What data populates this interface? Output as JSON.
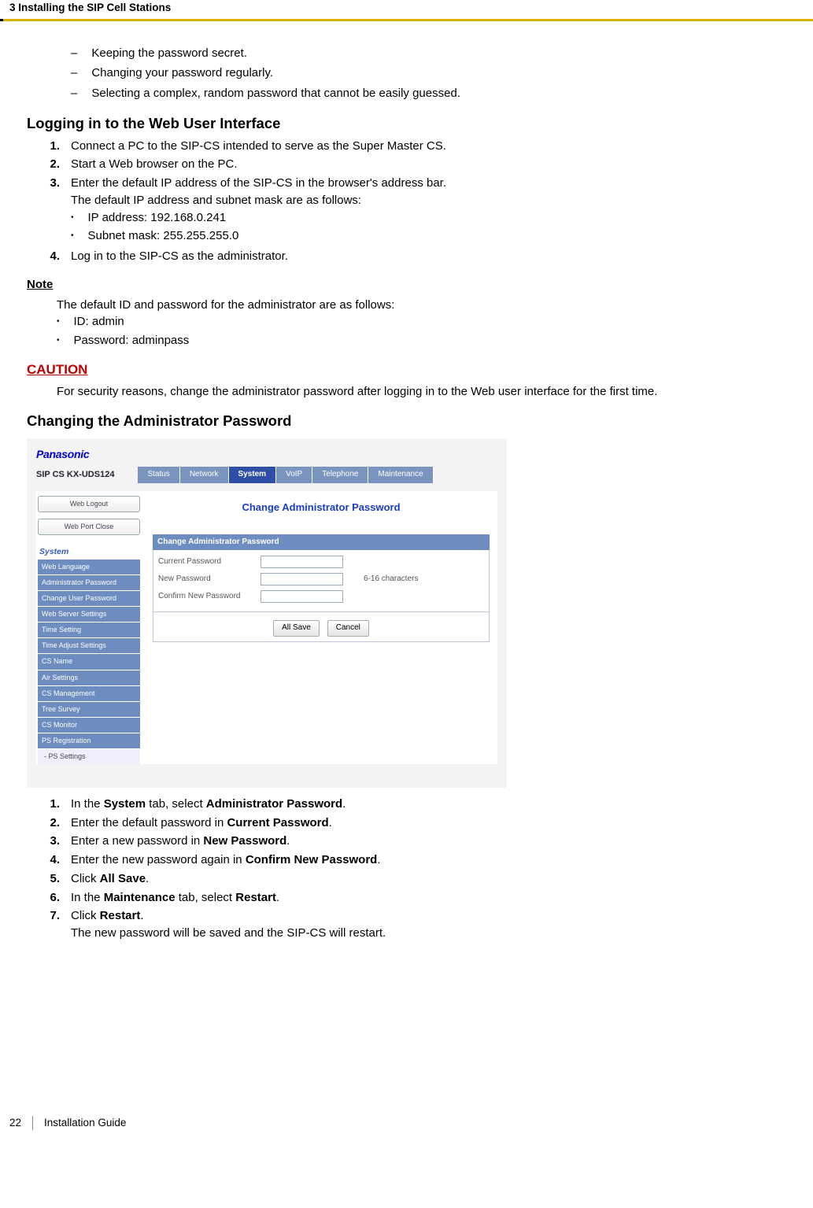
{
  "header": {
    "chapter": "3 Installing the SIP Cell Stations"
  },
  "intro_bullets": [
    "Keeping the password secret.",
    "Changing your password regularly.",
    "Selecting a complex, random password that cannot be easily guessed."
  ],
  "login": {
    "heading": "Logging in to the Web User Interface",
    "steps": {
      "1": "Connect a PC to the SIP-CS intended to serve as the Super Master CS.",
      "2": "Start a Web browser on the PC.",
      "3a": "Enter the default IP address of the SIP-CS in the browser's address bar.",
      "3b": "The default IP address and subnet mask are as follows:",
      "ip": "IP address: 192.168.0.241",
      "mask": "Subnet mask: 255.255.255.0",
      "4": "Log in to the SIP-CS as the administrator."
    }
  },
  "note": {
    "heading": "Note",
    "line": "The default ID and password for the administrator are as follows:",
    "id": "ID: admin",
    "pw": "Password: adminpass"
  },
  "caution": {
    "heading": "CAUTION",
    "text": "For security reasons, change the administrator password after logging in to the Web user interface for the first time."
  },
  "changepw": {
    "heading": "Changing the Administrator Password",
    "shot": {
      "brand": "Panasonic",
      "model": "SIP CS KX-UDS124",
      "tabs": [
        "Status",
        "Network",
        "System",
        "VoIP",
        "Telephone",
        "Maintenance"
      ],
      "active_tab_index": 2,
      "left_buttons": [
        "Web Logout",
        "Web Port Close"
      ],
      "side_heading": "System",
      "side_items": [
        "Web Language",
        "Administrator Password",
        "Change User Password",
        "Web Server Settings",
        "Time Setting",
        "Time Adjust Settings",
        "CS Name",
        "Air Settings",
        "CS Management",
        "Tree Survey",
        "CS Monitor",
        "PS Registration"
      ],
      "side_subitem": "- PS Settings",
      "main_title": "Change Administrator Password",
      "panel_title": "Change Administrator Password",
      "rows": {
        "current": "Current Password",
        "new": "New Password",
        "hint": "6-16 characters",
        "confirm": "Confirm New Password"
      },
      "buttons": {
        "save": "All Save",
        "cancel": "Cancel"
      }
    },
    "steps": {
      "1a": "In the ",
      "1b": "System",
      "1c": " tab, select ",
      "1d": "Administrator Password",
      "1e": ".",
      "2a": "Enter the default password in ",
      "2b": "Current Password",
      "2c": ".",
      "3a": "Enter a new password in ",
      "3b": "New Password",
      "3c": ".",
      "4a": "Enter the new password again in ",
      "4b": "Confirm New Password",
      "4c": ".",
      "5a": "Click ",
      "5b": "All Save",
      "5c": ".",
      "6a": "In the ",
      "6b": "Maintenance",
      "6c": " tab, select ",
      "6d": "Restart",
      "6e": ".",
      "7a": "Click ",
      "7b": "Restart",
      "7c": ".",
      "7d": "The new password will be saved and the SIP-CS will restart."
    }
  },
  "footer": {
    "page": "22",
    "doc": "Installation Guide"
  }
}
